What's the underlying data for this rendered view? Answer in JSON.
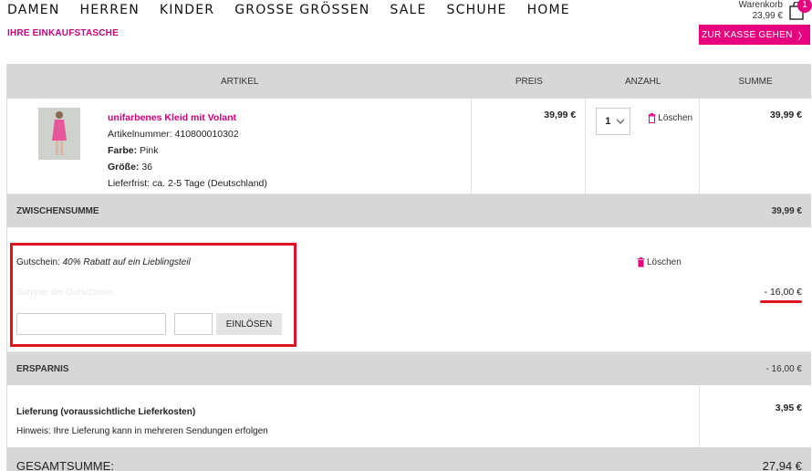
{
  "nav": {
    "items": [
      "DAMEN",
      "HERREN",
      "KINDER",
      "GROSSE GRÖSSEN",
      "SALE",
      "SCHUHE",
      "HOME"
    ]
  },
  "cart": {
    "label": "Warenkorb",
    "amount": "23,99 €",
    "count": "1"
  },
  "page": {
    "subtitle": "IHRE EINKAUFSTASCHE",
    "checkout_label": "ZUR KASSE GEHEN",
    "checkout_chevron": "〉"
  },
  "table": {
    "headers": {
      "artikel": "ARTIKEL",
      "preis": "PREIS",
      "anzahl": "ANZAHL",
      "summe": "SUMME"
    }
  },
  "item": {
    "name": "unifarbenes Kleid mit Volant",
    "article_number": "Artikelnummer: 410800010302",
    "color_label": "Farbe:",
    "color_value": "Pink",
    "size_label": "Größe:",
    "size_value": "36",
    "delivery": "Lieferfrist: ca. 2-5 Tage (Deutschland)",
    "price": "39,99 €",
    "quantity": "1",
    "delete_label": "Löschen",
    "sum": "39,99 €"
  },
  "subtotal": {
    "label": "ZWISCHENSUMME",
    "value": "39,99 €"
  },
  "coupon": {
    "label": "Gutschein:",
    "description": "40% Rabatt auf ein Lieblingsteil",
    "sum_label": "Summe der Gutscheine:",
    "redeem_label": "EINLÖSEN",
    "delete_label": "Löschen",
    "amount": "- 16,00 €"
  },
  "savings": {
    "label": "ERSPARNIS",
    "value": "- 16,00 €"
  },
  "delivery": {
    "label": "Lieferung (voraussichtliche Lieferkosten)",
    "note": "Hinweis: Ihre Lieferung kann in mehreren Sendungen erfolgen",
    "value": "3,95 €"
  },
  "total": {
    "label": "GESAMTSUMME:",
    "value": "27,94 €"
  },
  "colors": {
    "accent": "#e6007e",
    "highlight": "#e0141e",
    "bar": "#d7d7d7"
  }
}
